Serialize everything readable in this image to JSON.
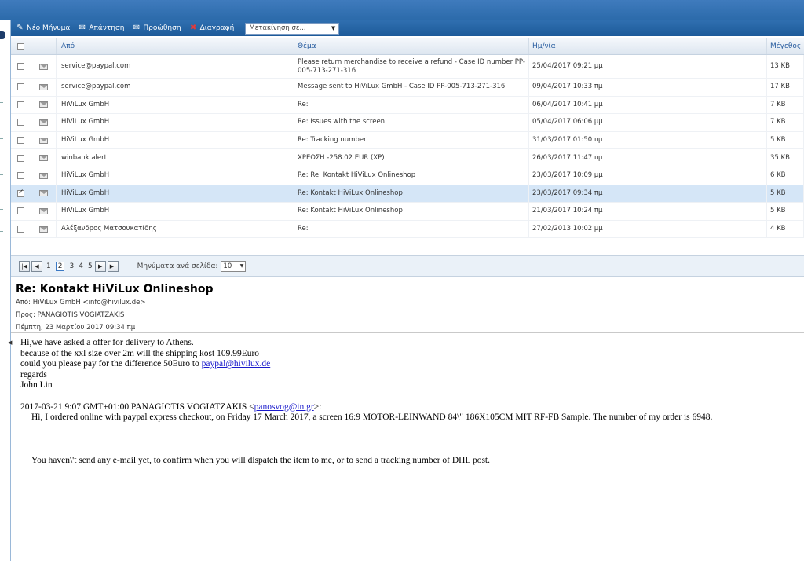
{
  "toolbar": {
    "new_message": "Νέο Μήνυμα",
    "reply": "Απάντηση",
    "forward": "Προώθηση",
    "delete": "Διαγραφή",
    "move_to": "Μετακίνηση σε..."
  },
  "grid": {
    "headers": {
      "from": "Από",
      "subject": "Θέμα",
      "date": "Ημ/νία",
      "size": "Μέγεθος"
    },
    "rows": [
      {
        "from": "service@paypal.com",
        "subject": "Please return merchandise to receive a refund - Case ID number PP-005-713-271-316",
        "date": "25/04/2017 09:21 μμ",
        "size": "13 KB",
        "checked": false
      },
      {
        "from": "service@paypal.com",
        "subject": "Message sent to HiViLux GmbH - Case ID PP-005-713-271-316",
        "date": "09/04/2017 10:33 πμ",
        "size": "17 KB",
        "checked": false
      },
      {
        "from": "HiViLux GmbH",
        "subject": "Re:",
        "date": "06/04/2017 10:41 μμ",
        "size": "7 KB",
        "checked": false
      },
      {
        "from": "HiViLux GmbH",
        "subject": "Re: Issues with the screen",
        "date": "05/04/2017 06:06 μμ",
        "size": "7 KB",
        "checked": false
      },
      {
        "from": "HiViLux GmbH",
        "subject": "Re: Tracking number",
        "date": "31/03/2017 01:50 πμ",
        "size": "5 KB",
        "checked": false
      },
      {
        "from": "winbank alert",
        "subject": "ΧΡΕΩΣΗ -258.02 EUR (XP)",
        "date": "26/03/2017 11:47 πμ",
        "size": "35 KB",
        "checked": false
      },
      {
        "from": "HiViLux GmbH",
        "subject": "Re: Re: Kontakt HiViLux Onlineshop",
        "date": "23/03/2017 10:09 μμ",
        "size": "6 KB",
        "checked": false
      },
      {
        "from": "HiViLux GmbH",
        "subject": "Re: Kontakt HiViLux Onlineshop",
        "date": "23/03/2017 09:34 πμ",
        "size": "5 KB",
        "checked": true
      },
      {
        "from": "HiViLux GmbH",
        "subject": "Re: Kontakt HiViLux Onlineshop",
        "date": "21/03/2017 10:24 πμ",
        "size": "5 KB",
        "checked": false
      },
      {
        "from": "Αλέξανδρος Ματσουκατίδης",
        "subject": "Re:",
        "date": "27/02/2013 10:02 μμ",
        "size": "4 KB",
        "checked": false
      }
    ]
  },
  "pager": {
    "pages": [
      "1",
      "2",
      "3",
      "4",
      "5"
    ],
    "current": "2",
    "per_page_label": "Μηνύματα ανά σελίδα:",
    "per_page_value": "10"
  },
  "message": {
    "subject": "Re: Kontakt HiViLux Onlineshop",
    "from": "Από: HiViLux GmbH <info@hivilux.de>",
    "to": "Προς: PANAGIOTIS VOGIATZAKIS",
    "date": "Πέμπτη, 23 Μαρτίου 2017 09:34 πμ",
    "body_line1": "Hi,we have asked a offer for delivery to Athens.",
    "body_line2": "because of the xxl size over 2m will the shipping kost 109.99Euro",
    "body_line3_prefix": "could you please pay for the difference 50Euro to ",
    "body_line3_link": "paypal@hivilux.de",
    "body_line4": "regards",
    "body_line5": "John Lin",
    "quote_header_prefix": "2017-03-21 9:07 GMT+01:00 PANAGIOTIS VOGIATZAKIS <",
    "quote_header_link": "panosvog@in.gr",
    "quote_header_suffix": ">:",
    "quote_line1": "Hi, I ordered online with paypal express checkout, on Friday 17 March 2017, a screen 16:9 MOTOR-LEINWAND 84\\\" 186X105CM MIT RF-FB Sample. The number of my order is 6948.",
    "quote_line2": "You haven\\'t send any e-mail yet, to confirm when you will dispatch the item to me, or to send a tracking number of DHL post."
  }
}
